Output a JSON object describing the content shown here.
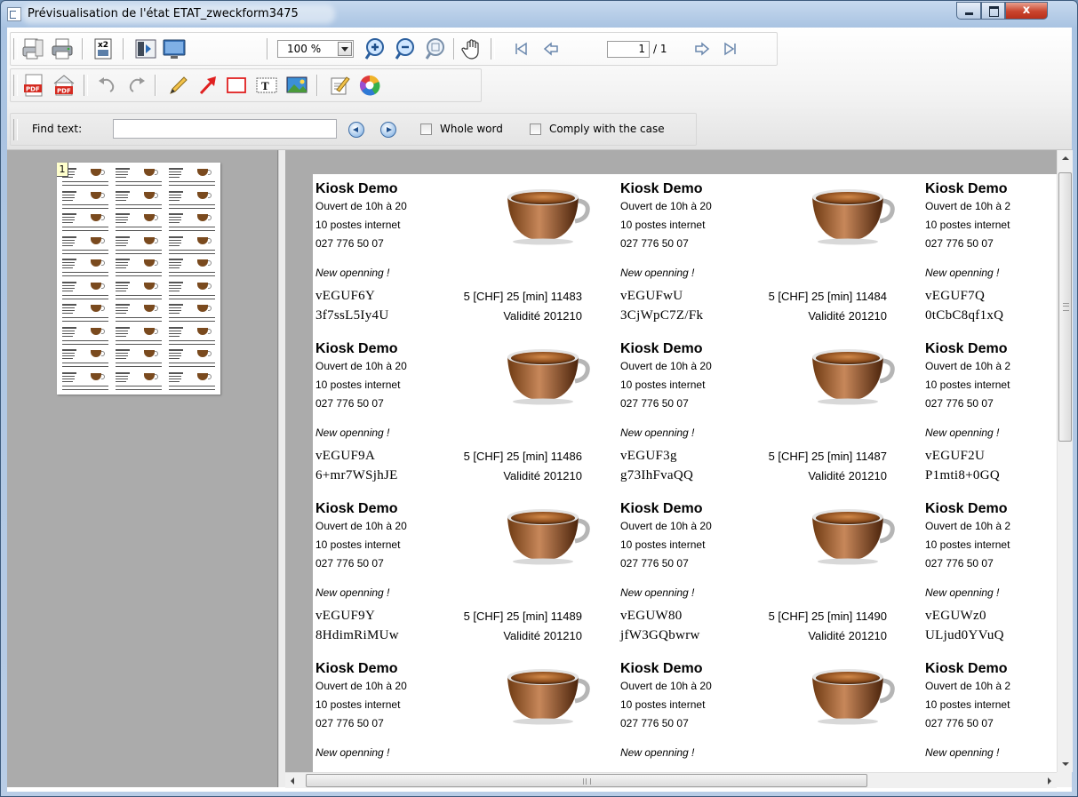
{
  "window": {
    "title": "Prévisualisation de l'état ETAT_zweckform3475",
    "close_glyph": "x"
  },
  "toolbar": {
    "zoom_value": "100 %",
    "page_current": "1",
    "page_total": "/ 1",
    "icons_row1": [
      "print-setup-icon",
      "printer-icon",
      "multi-page-icon",
      "fit-page-icon",
      "fullscreen-icon",
      "zoom-in-icon",
      "zoom-out-icon",
      "zoom-fit-icon",
      "hand-icon",
      "first-page-icon",
      "previous-page-icon",
      "next-page-icon",
      "last-page-icon"
    ],
    "icons_row2": [
      "pdf-icon",
      "pdf-export-icon",
      "undo-icon",
      "redo-icon",
      "pencil-icon",
      "arrow-icon",
      "rectangle-icon",
      "text-box-icon",
      "image-icon",
      "edit-icon",
      "color-wheel-icon"
    ]
  },
  "find": {
    "label": "Find text:",
    "value": "",
    "whole_word_label": "Whole word",
    "whole_word_checked": false,
    "case_label": "Comply with the case",
    "case_checked": false
  },
  "thumbnail": {
    "page_number": "1"
  },
  "cards": [
    {
      "title": "Kiosk Demo",
      "hours": "Ouvert de 10h à 20",
      "postes": "10 postes internet",
      "phone": "027 776 50 07",
      "tagline": "New openning !",
      "code1": "vEGUF6Y",
      "price": "5 [CHF] 25 [min] 11483",
      "code2": "3f7ssL5Iy4U",
      "validity": "Validité 201210"
    },
    {
      "title": "Kiosk Demo",
      "hours": "Ouvert de 10h à 20",
      "postes": "10 postes internet",
      "phone": "027 776 50 07",
      "tagline": "New openning !",
      "code1": "vEGUFwU",
      "price": "5 [CHF] 25 [min] 11484",
      "code2": "3CjWpC7Z/Fk",
      "validity": "Validité 201210"
    },
    {
      "title": "Kiosk Demo",
      "hours": "Ouvert de 10h à 2",
      "postes": "10 postes internet",
      "phone": "027 776 50 07",
      "tagline": "New openning !",
      "code1": "vEGUF7Q",
      "price": "",
      "code2": "0tCbC8qf1xQ",
      "validity": ""
    },
    {
      "title": "Kiosk Demo",
      "hours": "Ouvert de 10h à 20",
      "postes": "10 postes internet",
      "phone": "027 776 50 07",
      "tagline": "New openning !",
      "code1": "vEGUF9A",
      "price": "5 [CHF] 25 [min] 11486",
      "code2": "6+mr7WSjhJE",
      "validity": "Validité 201210"
    },
    {
      "title": "Kiosk Demo",
      "hours": "Ouvert de 10h à 20",
      "postes": "10 postes internet",
      "phone": "027 776 50 07",
      "tagline": "New openning !",
      "code1": "vEGUF3g",
      "price": "5 [CHF] 25 [min] 11487",
      "code2": "g73IhFvaQQ",
      "validity": "Validité 201210"
    },
    {
      "title": "Kiosk Demo",
      "hours": "Ouvert de 10h à 2",
      "postes": "10 postes internet",
      "phone": "027 776 50 07",
      "tagline": "New openning !",
      "code1": "vEGUF2U",
      "price": "",
      "code2": "P1mti8+0GQ",
      "validity": ""
    },
    {
      "title": "Kiosk Demo",
      "hours": "Ouvert de 10h à 20",
      "postes": "10 postes internet",
      "phone": "027 776 50 07",
      "tagline": "New openning !",
      "code1": "vEGUF9Y",
      "price": "5 [CHF] 25 [min] 11489",
      "code2": "8HdimRiMUw",
      "validity": "Validité 201210"
    },
    {
      "title": "Kiosk Demo",
      "hours": "Ouvert de 10h à 20",
      "postes": "10 postes internet",
      "phone": "027 776 50 07",
      "tagline": "New openning !",
      "code1": "vEGUW80",
      "price": "5 [CHF] 25 [min] 11490",
      "code2": "jfW3GQbwrw",
      "validity": "Validité 201210"
    },
    {
      "title": "Kiosk Demo",
      "hours": "Ouvert de 10h à 2",
      "postes": "10 postes internet",
      "phone": "027 776 50 07",
      "tagline": "New openning !",
      "code1": "vEGUWz0",
      "price": "",
      "code2": "ULjud0YVuQ",
      "validity": ""
    },
    {
      "title": "Kiosk Demo",
      "hours": "Ouvert de 10h à 20",
      "postes": "10 postes internet",
      "phone": "027 776 50 07",
      "tagline": "New openning !",
      "code1": "",
      "price": "",
      "code2": "",
      "validity": ""
    },
    {
      "title": "Kiosk Demo",
      "hours": "Ouvert de 10h à 20",
      "postes": "10 postes internet",
      "phone": "027 776 50 07",
      "tagline": "New openning !",
      "code1": "",
      "price": "",
      "code2": "",
      "validity": ""
    },
    {
      "title": "Kiosk Demo",
      "hours": "Ouvert de 10h à 2",
      "postes": "10 postes internet",
      "phone": "027 776 50 07",
      "tagline": "New openning !",
      "code1": "",
      "price": "",
      "code2": "",
      "validity": ""
    }
  ],
  "scrollbars": {
    "horizontal_grip": "III"
  },
  "colors": {
    "title_bar": "#b9cde6",
    "close_button": "#c9442d",
    "panel_gray": "#ababab",
    "accent_red": "#e02020"
  }
}
